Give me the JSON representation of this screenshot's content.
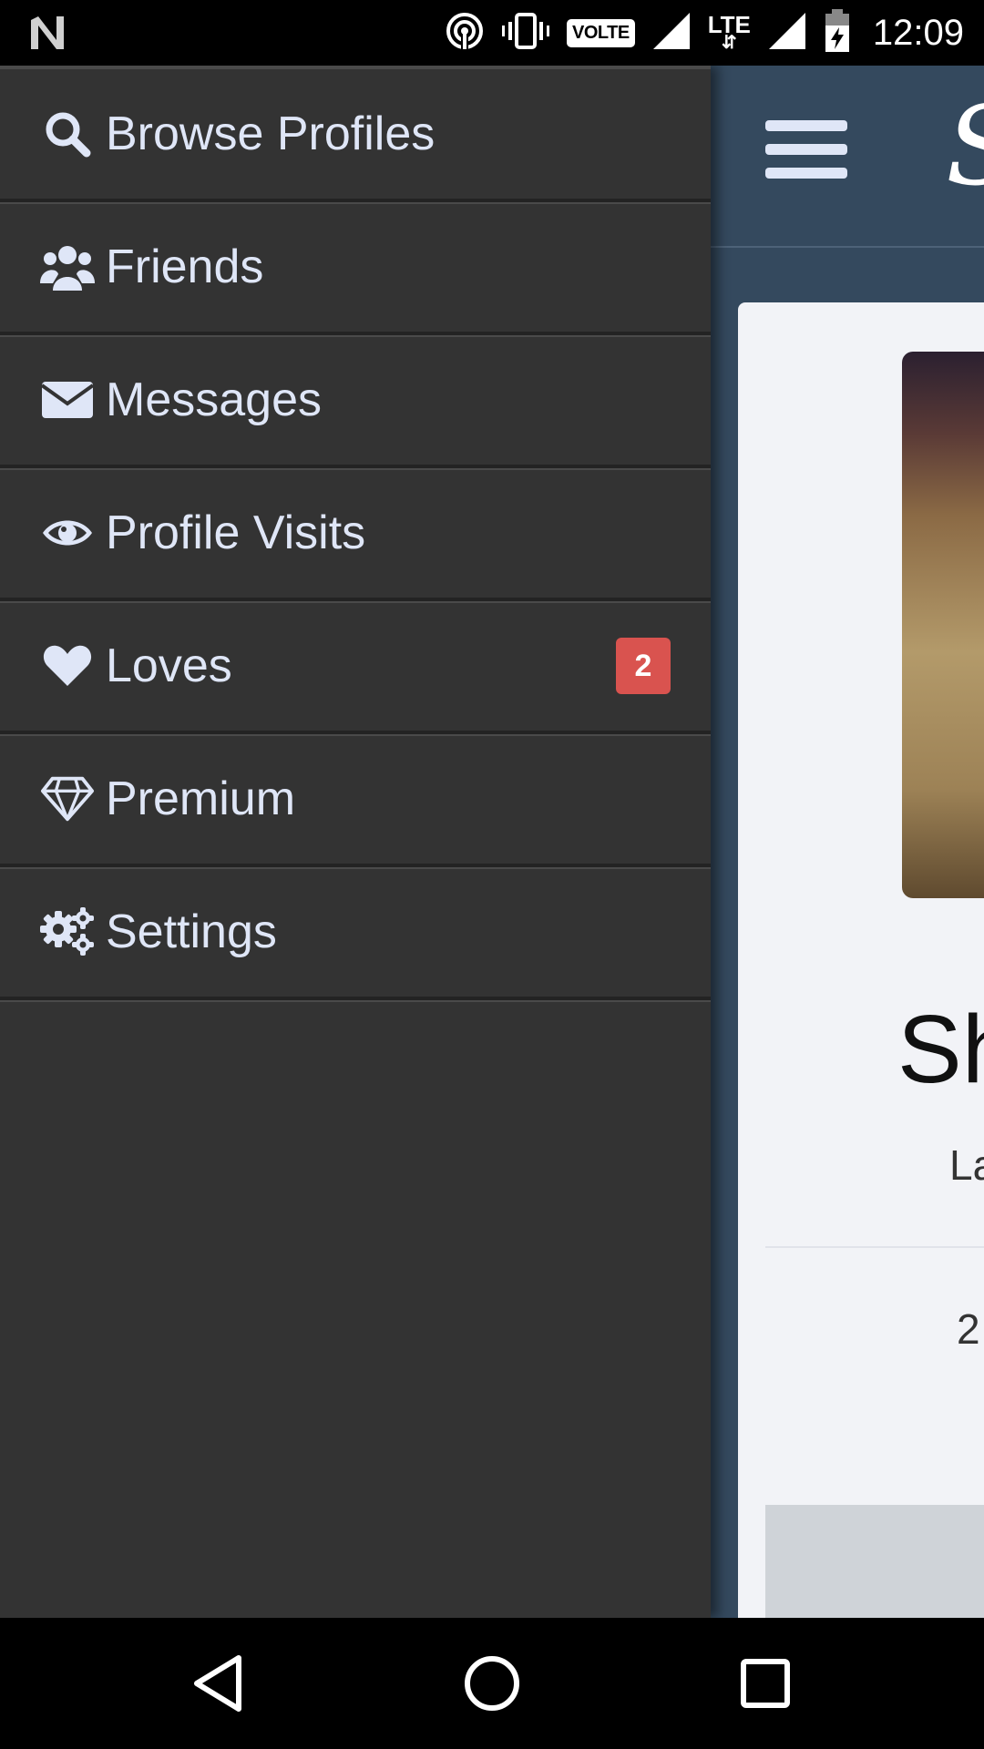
{
  "status_bar": {
    "volte_label": "VOLTE",
    "network_label": "LTE",
    "time": "12:09",
    "icons": [
      "n-notification-icon",
      "hotspot-icon",
      "vibrate-icon",
      "signal-icon",
      "lte-arrows-icon",
      "signal-icon",
      "battery-charging-icon"
    ]
  },
  "drawer": {
    "items": [
      {
        "label": "Browse Profiles",
        "icon": "search-icon"
      },
      {
        "label": "Friends",
        "icon": "users-icon"
      },
      {
        "label": "Messages",
        "icon": "envelope-icon"
      },
      {
        "label": "Profile Visits",
        "icon": "eye-icon"
      },
      {
        "label": "Loves",
        "icon": "heart-icon",
        "badge": "2"
      },
      {
        "label": "Premium",
        "icon": "diamond-icon"
      },
      {
        "label": "Settings",
        "icon": "gears-icon"
      }
    ]
  },
  "background_app": {
    "logo_fragment": "S",
    "name_fragment": "Sh",
    "location_fragment": "La",
    "age_fragment": "2"
  },
  "navigation": {
    "buttons": [
      "back-icon",
      "home-icon",
      "recents-icon"
    ]
  },
  "colors": {
    "drawer_bg": "#333333",
    "drawer_text": "#dfe6f7",
    "badge_bg": "#d9534f",
    "app_header_bg": "#34495e"
  }
}
